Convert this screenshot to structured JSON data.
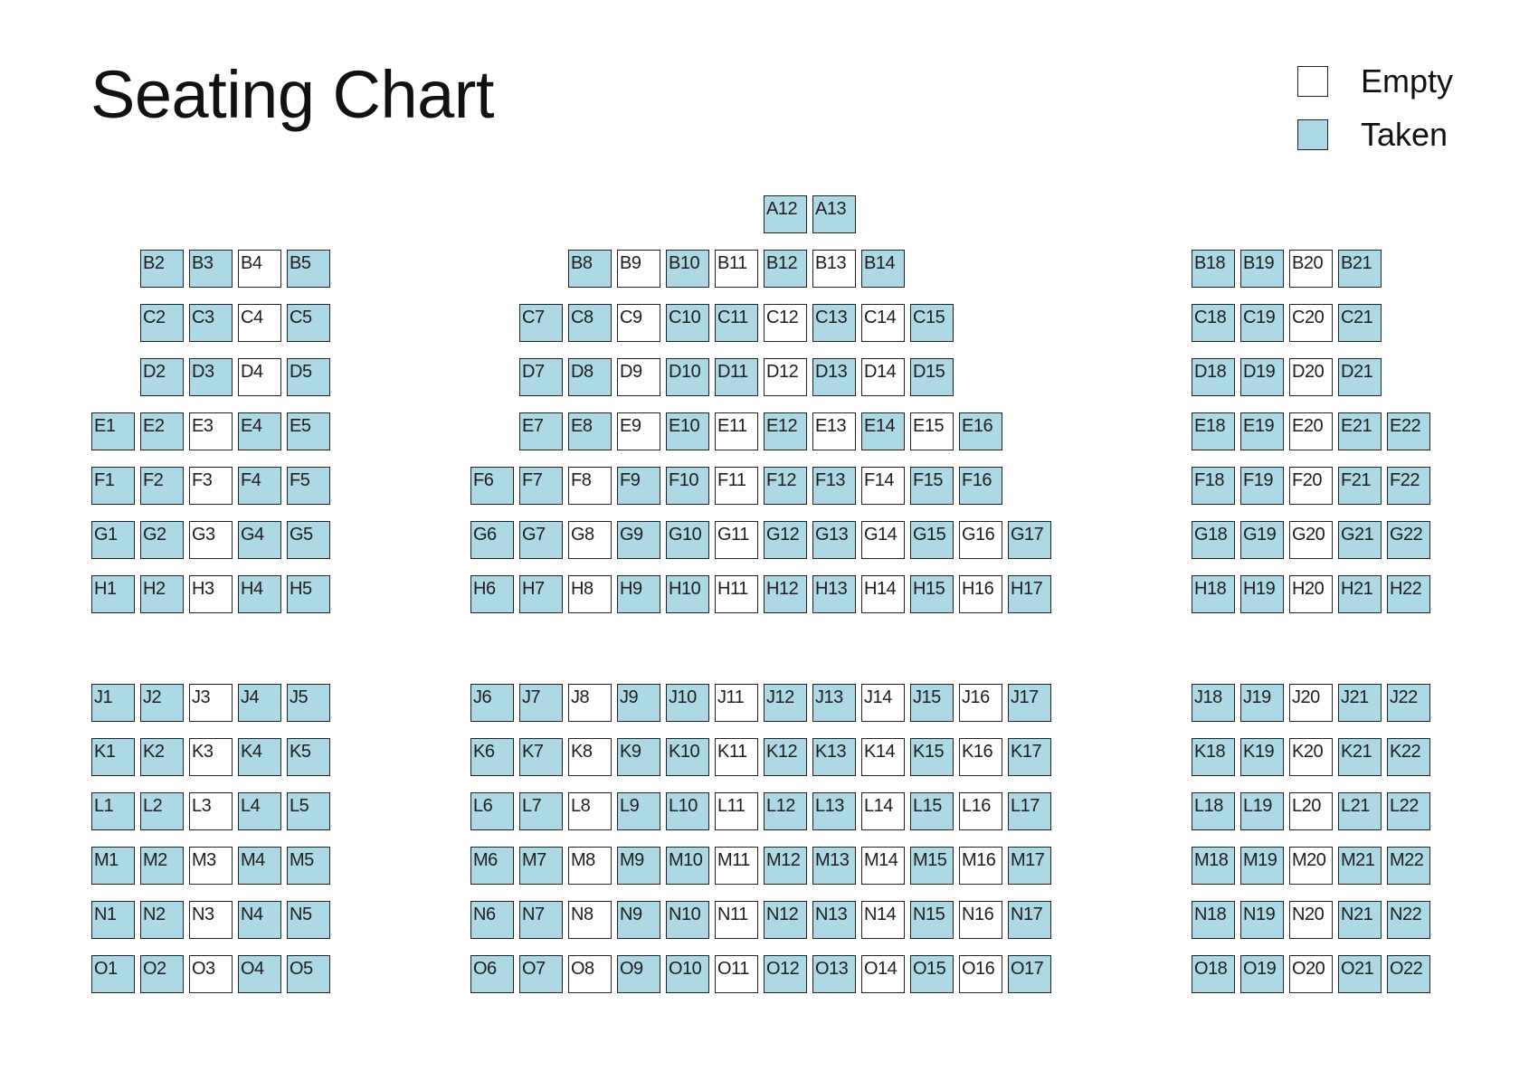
{
  "title": "Seating Chart",
  "legend": {
    "items": [
      {
        "label": "Empty",
        "status": "empty",
        "color": "#ffffff"
      },
      {
        "label": "Taken",
        "status": "taken",
        "color": "#add8e6"
      }
    ]
  },
  "colors": {
    "taken": "#add8e6",
    "empty": "#ffffff",
    "border": "#222222"
  },
  "rows": [
    {
      "row": "A",
      "seats": [
        {
          "id": "A12",
          "taken": true
        },
        {
          "id": "A13",
          "taken": true
        }
      ]
    },
    {
      "row": "B",
      "seats": [
        {
          "id": "B2",
          "taken": true
        },
        {
          "id": "B3",
          "taken": true
        },
        {
          "id": "B4",
          "taken": false
        },
        {
          "id": "B5",
          "taken": true
        },
        {
          "id": "B8",
          "taken": true
        },
        {
          "id": "B9",
          "taken": false
        },
        {
          "id": "B10",
          "taken": true
        },
        {
          "id": "B11",
          "taken": false
        },
        {
          "id": "B12",
          "taken": true
        },
        {
          "id": "B13",
          "taken": false
        },
        {
          "id": "B14",
          "taken": true
        },
        {
          "id": "B18",
          "taken": true
        },
        {
          "id": "B19",
          "taken": true
        },
        {
          "id": "B20",
          "taken": false
        },
        {
          "id": "B21",
          "taken": true
        }
      ]
    },
    {
      "row": "C",
      "seats": [
        {
          "id": "C2",
          "taken": true
        },
        {
          "id": "C3",
          "taken": true
        },
        {
          "id": "C4",
          "taken": false
        },
        {
          "id": "C5",
          "taken": true
        },
        {
          "id": "C7",
          "taken": true
        },
        {
          "id": "C8",
          "taken": true
        },
        {
          "id": "C9",
          "taken": false
        },
        {
          "id": "C10",
          "taken": true
        },
        {
          "id": "C11",
          "taken": true
        },
        {
          "id": "C12",
          "taken": false
        },
        {
          "id": "C13",
          "taken": true
        },
        {
          "id": "C14",
          "taken": false
        },
        {
          "id": "C15",
          "taken": true
        },
        {
          "id": "C18",
          "taken": true
        },
        {
          "id": "C19",
          "taken": true
        },
        {
          "id": "C20",
          "taken": false
        },
        {
          "id": "C21",
          "taken": true
        }
      ]
    },
    {
      "row": "D",
      "seats": [
        {
          "id": "D2",
          "taken": true
        },
        {
          "id": "D3",
          "taken": true
        },
        {
          "id": "D4",
          "taken": false
        },
        {
          "id": "D5",
          "taken": true
        },
        {
          "id": "D7",
          "taken": true
        },
        {
          "id": "D8",
          "taken": true
        },
        {
          "id": "D9",
          "taken": false
        },
        {
          "id": "D10",
          "taken": true
        },
        {
          "id": "D11",
          "taken": true
        },
        {
          "id": "D12",
          "taken": false
        },
        {
          "id": "D13",
          "taken": true
        },
        {
          "id": "D14",
          "taken": false
        },
        {
          "id": "D15",
          "taken": true
        },
        {
          "id": "D18",
          "taken": true
        },
        {
          "id": "D19",
          "taken": true
        },
        {
          "id": "D20",
          "taken": false
        },
        {
          "id": "D21",
          "taken": true
        }
      ]
    },
    {
      "row": "E",
      "seats": [
        {
          "id": "E1",
          "taken": true
        },
        {
          "id": "E2",
          "taken": true
        },
        {
          "id": "E3",
          "taken": false
        },
        {
          "id": "E4",
          "taken": true
        },
        {
          "id": "E5",
          "taken": true
        },
        {
          "id": "E7",
          "taken": true
        },
        {
          "id": "E8",
          "taken": true
        },
        {
          "id": "E9",
          "taken": false
        },
        {
          "id": "E10",
          "taken": true
        },
        {
          "id": "E11",
          "taken": false
        },
        {
          "id": "E12",
          "taken": true
        },
        {
          "id": "E13",
          "taken": false
        },
        {
          "id": "E14",
          "taken": true
        },
        {
          "id": "E15",
          "taken": false
        },
        {
          "id": "E16",
          "taken": true
        },
        {
          "id": "E18",
          "taken": true
        },
        {
          "id": "E19",
          "taken": true
        },
        {
          "id": "E20",
          "taken": false
        },
        {
          "id": "E21",
          "taken": true
        },
        {
          "id": "E22",
          "taken": true
        }
      ]
    },
    {
      "row": "F",
      "seats": [
        {
          "id": "F1",
          "taken": true
        },
        {
          "id": "F2",
          "taken": true
        },
        {
          "id": "F3",
          "taken": false
        },
        {
          "id": "F4",
          "taken": true
        },
        {
          "id": "F5",
          "taken": true
        },
        {
          "id": "F6",
          "taken": true
        },
        {
          "id": "F7",
          "taken": true
        },
        {
          "id": "F8",
          "taken": false
        },
        {
          "id": "F9",
          "taken": true
        },
        {
          "id": "F10",
          "taken": true
        },
        {
          "id": "F11",
          "taken": false
        },
        {
          "id": "F12",
          "taken": true
        },
        {
          "id": "F13",
          "taken": true
        },
        {
          "id": "F14",
          "taken": false
        },
        {
          "id": "F15",
          "taken": true
        },
        {
          "id": "F16",
          "taken": true
        },
        {
          "id": "F18",
          "taken": true
        },
        {
          "id": "F19",
          "taken": true
        },
        {
          "id": "F20",
          "taken": false
        },
        {
          "id": "F21",
          "taken": true
        },
        {
          "id": "F22",
          "taken": true
        }
      ]
    },
    {
      "row": "G",
      "seats": [
        {
          "id": "G1",
          "taken": true
        },
        {
          "id": "G2",
          "taken": true
        },
        {
          "id": "G3",
          "taken": false
        },
        {
          "id": "G4",
          "taken": true
        },
        {
          "id": "G5",
          "taken": true
        },
        {
          "id": "G6",
          "taken": true
        },
        {
          "id": "G7",
          "taken": true
        },
        {
          "id": "G8",
          "taken": false
        },
        {
          "id": "G9",
          "taken": true
        },
        {
          "id": "G10",
          "taken": true
        },
        {
          "id": "G11",
          "taken": false
        },
        {
          "id": "G12",
          "taken": true
        },
        {
          "id": "G13",
          "taken": true
        },
        {
          "id": "G14",
          "taken": false
        },
        {
          "id": "G15",
          "taken": true
        },
        {
          "id": "G16",
          "taken": false
        },
        {
          "id": "G17",
          "taken": true
        },
        {
          "id": "G18",
          "taken": true
        },
        {
          "id": "G19",
          "taken": true
        },
        {
          "id": "G20",
          "taken": false
        },
        {
          "id": "G21",
          "taken": true
        },
        {
          "id": "G22",
          "taken": true
        }
      ]
    },
    {
      "row": "H",
      "seats": [
        {
          "id": "H1",
          "taken": true
        },
        {
          "id": "H2",
          "taken": true
        },
        {
          "id": "H3",
          "taken": false
        },
        {
          "id": "H4",
          "taken": true
        },
        {
          "id": "H5",
          "taken": true
        },
        {
          "id": "H6",
          "taken": true
        },
        {
          "id": "H7",
          "taken": true
        },
        {
          "id": "H8",
          "taken": false
        },
        {
          "id": "H9",
          "taken": true
        },
        {
          "id": "H10",
          "taken": true
        },
        {
          "id": "H11",
          "taken": false
        },
        {
          "id": "H12",
          "taken": true
        },
        {
          "id": "H13",
          "taken": true
        },
        {
          "id": "H14",
          "taken": false
        },
        {
          "id": "H15",
          "taken": true
        },
        {
          "id": "H16",
          "taken": false
        },
        {
          "id": "H17",
          "taken": true
        },
        {
          "id": "H18",
          "taken": true
        },
        {
          "id": "H19",
          "taken": true
        },
        {
          "id": "H20",
          "taken": false
        },
        {
          "id": "H21",
          "taken": true
        },
        {
          "id": "H22",
          "taken": true
        }
      ]
    },
    {
      "row": "J",
      "seats": [
        {
          "id": "J1",
          "taken": true
        },
        {
          "id": "J2",
          "taken": true
        },
        {
          "id": "J3",
          "taken": false
        },
        {
          "id": "J4",
          "taken": true
        },
        {
          "id": "J5",
          "taken": true
        },
        {
          "id": "J6",
          "taken": true
        },
        {
          "id": "J7",
          "taken": true
        },
        {
          "id": "J8",
          "taken": false
        },
        {
          "id": "J9",
          "taken": true
        },
        {
          "id": "J10",
          "taken": true
        },
        {
          "id": "J11",
          "taken": false
        },
        {
          "id": "J12",
          "taken": true
        },
        {
          "id": "J13",
          "taken": true
        },
        {
          "id": "J14",
          "taken": false
        },
        {
          "id": "J15",
          "taken": true
        },
        {
          "id": "J16",
          "taken": false
        },
        {
          "id": "J17",
          "taken": true
        },
        {
          "id": "J18",
          "taken": true
        },
        {
          "id": "J19",
          "taken": true
        },
        {
          "id": "J20",
          "taken": false
        },
        {
          "id": "J21",
          "taken": true
        },
        {
          "id": "J22",
          "taken": true
        }
      ]
    },
    {
      "row": "K",
      "seats": [
        {
          "id": "K1",
          "taken": true
        },
        {
          "id": "K2",
          "taken": true
        },
        {
          "id": "K3",
          "taken": false
        },
        {
          "id": "K4",
          "taken": true
        },
        {
          "id": "K5",
          "taken": true
        },
        {
          "id": "K6",
          "taken": true
        },
        {
          "id": "K7",
          "taken": true
        },
        {
          "id": "K8",
          "taken": false
        },
        {
          "id": "K9",
          "taken": true
        },
        {
          "id": "K10",
          "taken": true
        },
        {
          "id": "K11",
          "taken": false
        },
        {
          "id": "K12",
          "taken": true
        },
        {
          "id": "K13",
          "taken": true
        },
        {
          "id": "K14",
          "taken": false
        },
        {
          "id": "K15",
          "taken": true
        },
        {
          "id": "K16",
          "taken": false
        },
        {
          "id": "K17",
          "taken": true
        },
        {
          "id": "K18",
          "taken": true
        },
        {
          "id": "K19",
          "taken": true
        },
        {
          "id": "K20",
          "taken": false
        },
        {
          "id": "K21",
          "taken": true
        },
        {
          "id": "K22",
          "taken": true
        }
      ]
    },
    {
      "row": "L",
      "seats": [
        {
          "id": "L1",
          "taken": true
        },
        {
          "id": "L2",
          "taken": true
        },
        {
          "id": "L3",
          "taken": false
        },
        {
          "id": "L4",
          "taken": true
        },
        {
          "id": "L5",
          "taken": true
        },
        {
          "id": "L6",
          "taken": true
        },
        {
          "id": "L7",
          "taken": true
        },
        {
          "id": "L8",
          "taken": false
        },
        {
          "id": "L9",
          "taken": true
        },
        {
          "id": "L10",
          "taken": true
        },
        {
          "id": "L11",
          "taken": false
        },
        {
          "id": "L12",
          "taken": true
        },
        {
          "id": "L13",
          "taken": true
        },
        {
          "id": "L14",
          "taken": false
        },
        {
          "id": "L15",
          "taken": true
        },
        {
          "id": "L16",
          "taken": false
        },
        {
          "id": "L17",
          "taken": true
        },
        {
          "id": "L18",
          "taken": true
        },
        {
          "id": "L19",
          "taken": true
        },
        {
          "id": "L20",
          "taken": false
        },
        {
          "id": "L21",
          "taken": true
        },
        {
          "id": "L22",
          "taken": true
        }
      ]
    },
    {
      "row": "M",
      "seats": [
        {
          "id": "M1",
          "taken": true
        },
        {
          "id": "M2",
          "taken": true
        },
        {
          "id": "M3",
          "taken": false
        },
        {
          "id": "M4",
          "taken": true
        },
        {
          "id": "M5",
          "taken": true
        },
        {
          "id": "M6",
          "taken": true
        },
        {
          "id": "M7",
          "taken": true
        },
        {
          "id": "M8",
          "taken": false
        },
        {
          "id": "M9",
          "taken": true
        },
        {
          "id": "M10",
          "taken": true
        },
        {
          "id": "M11",
          "taken": false
        },
        {
          "id": "M12",
          "taken": true
        },
        {
          "id": "M13",
          "taken": true
        },
        {
          "id": "M14",
          "taken": false
        },
        {
          "id": "M15",
          "taken": true
        },
        {
          "id": "M16",
          "taken": false
        },
        {
          "id": "M17",
          "taken": true
        },
        {
          "id": "M18",
          "taken": true
        },
        {
          "id": "M19",
          "taken": true
        },
        {
          "id": "M20",
          "taken": false
        },
        {
          "id": "M21",
          "taken": true
        },
        {
          "id": "M22",
          "taken": true
        }
      ]
    },
    {
      "row": "N",
      "seats": [
        {
          "id": "N1",
          "taken": true
        },
        {
          "id": "N2",
          "taken": true
        },
        {
          "id": "N3",
          "taken": false
        },
        {
          "id": "N4",
          "taken": true
        },
        {
          "id": "N5",
          "taken": true
        },
        {
          "id": "N6",
          "taken": true
        },
        {
          "id": "N7",
          "taken": true
        },
        {
          "id": "N8",
          "taken": false
        },
        {
          "id": "N9",
          "taken": true
        },
        {
          "id": "N10",
          "taken": true
        },
        {
          "id": "N11",
          "taken": false
        },
        {
          "id": "N12",
          "taken": true
        },
        {
          "id": "N13",
          "taken": true
        },
        {
          "id": "N14",
          "taken": false
        },
        {
          "id": "N15",
          "taken": true
        },
        {
          "id": "N16",
          "taken": false
        },
        {
          "id": "N17",
          "taken": true
        },
        {
          "id": "N18",
          "taken": true
        },
        {
          "id": "N19",
          "taken": true
        },
        {
          "id": "N20",
          "taken": false
        },
        {
          "id": "N21",
          "taken": true
        },
        {
          "id": "N22",
          "taken": true
        }
      ]
    },
    {
      "row": "O",
      "seats": [
        {
          "id": "O1",
          "taken": true
        },
        {
          "id": "O2",
          "taken": true
        },
        {
          "id": "O3",
          "taken": false
        },
        {
          "id": "O4",
          "taken": true
        },
        {
          "id": "O5",
          "taken": true
        },
        {
          "id": "O6",
          "taken": true
        },
        {
          "id": "O7",
          "taken": true
        },
        {
          "id": "O8",
          "taken": false
        },
        {
          "id": "O9",
          "taken": true
        },
        {
          "id": "O10",
          "taken": true
        },
        {
          "id": "O11",
          "taken": false
        },
        {
          "id": "O12",
          "taken": true
        },
        {
          "id": "O13",
          "taken": true
        },
        {
          "id": "O14",
          "taken": false
        },
        {
          "id": "O15",
          "taken": true
        },
        {
          "id": "O16",
          "taken": false
        },
        {
          "id": "O17",
          "taken": true
        },
        {
          "id": "O18",
          "taken": true
        },
        {
          "id": "O19",
          "taken": true
        },
        {
          "id": "O20",
          "taken": false
        },
        {
          "id": "O21",
          "taken": true
        },
        {
          "id": "O22",
          "taken": true
        }
      ]
    }
  ]
}
